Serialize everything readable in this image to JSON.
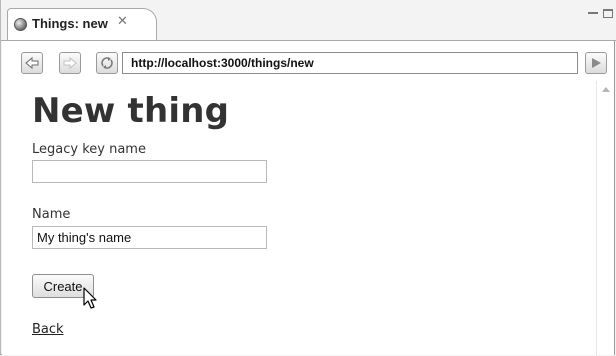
{
  "browser": {
    "tab_title": "Things: new",
    "url": "http://localhost:3000/things/new",
    "icons": {
      "tab": "globe-icon",
      "close": "close-icon",
      "back": "back-arrow-icon",
      "forward": "forward-arrow-icon",
      "refresh": "refresh-icon",
      "go": "go-arrow-icon",
      "minimize": "minimize-icon",
      "maximize": "maximize-icon"
    }
  },
  "page": {
    "title": "New thing",
    "form": {
      "legacy_key_name": {
        "label": "Legacy key name",
        "value": ""
      },
      "name": {
        "label": "Name",
        "value": "My thing's name"
      },
      "submit_label": "Create"
    },
    "back_link": "Back"
  }
}
